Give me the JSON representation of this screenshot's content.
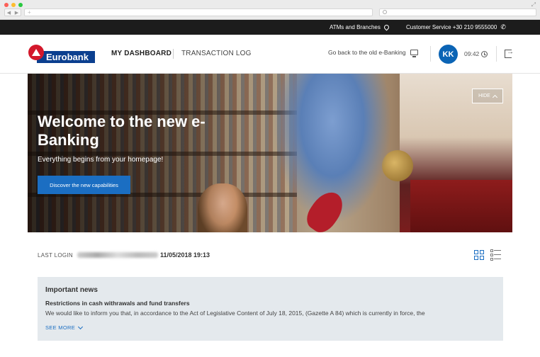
{
  "topbar": {
    "atms_label": "ATMs and Branches",
    "customer_service": "Customer Service +30 210 9555000"
  },
  "header": {
    "logo_text": "Eurobank",
    "nav": {
      "dashboard": "MY DASHBOARD",
      "transaction_log": "TRANSACTION LOG"
    },
    "old_ebanking": "Go back to the old e-Banking",
    "avatar_initials": "KK",
    "session_time": "09:42"
  },
  "hero": {
    "title": "Welcome to the new e-Banking",
    "subtitle": "Everything begins from your homepage!",
    "cta": "Discover the new capabilities",
    "hide": "HIDE"
  },
  "last_login": {
    "label": "LAST LOGIN",
    "datetime": "11/05/2018 19:13"
  },
  "news": {
    "title": "Important news",
    "headline": "Restrictions in cash withrawals and fund transfers",
    "body": "We would like to inform you that, in accordance to the Act of Legislative Content of July 18, 2015, (Gazette A 84) which is currently in force, the",
    "see_more": "SEE MORE"
  },
  "colors": {
    "brand_blue": "#0b3f8f",
    "brand_red": "#d3182b",
    "accent_blue": "#1b6ec2",
    "topbar_bg": "#1c1c1c",
    "news_bg": "#e4e9ed"
  },
  "icons": [
    "map-pin-icon",
    "phone-icon",
    "monitor-icon",
    "clock-history-icon",
    "logout-icon",
    "chevron-up-icon",
    "grid-view-icon",
    "list-view-icon",
    "chevron-down-icon"
  ]
}
